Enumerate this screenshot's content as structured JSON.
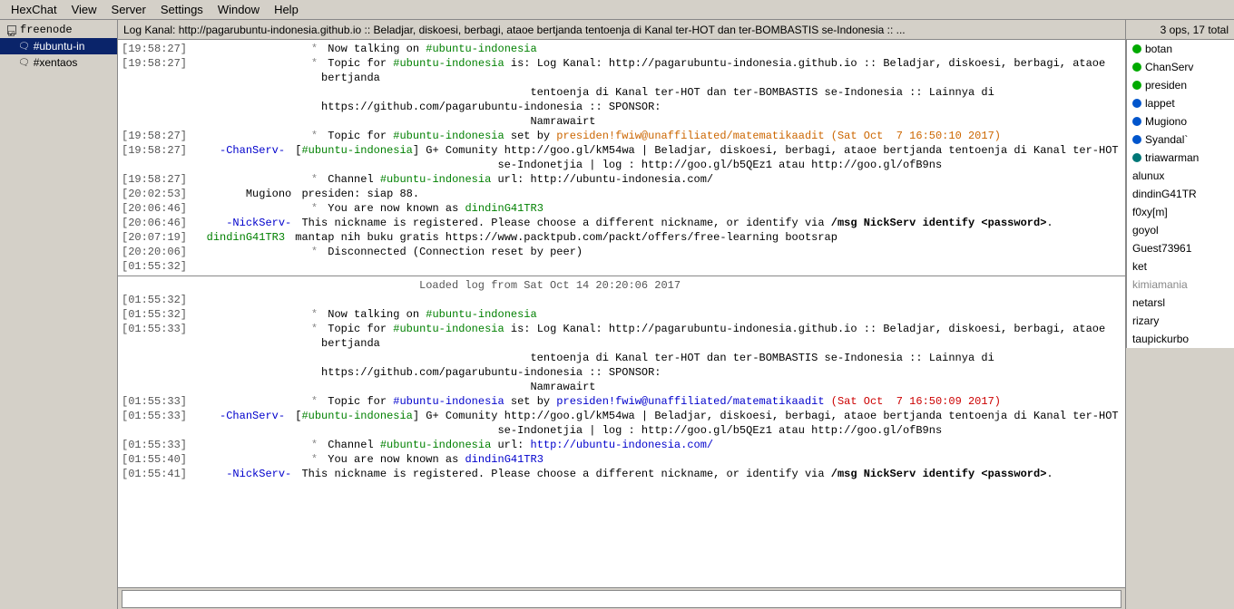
{
  "menubar": {
    "items": [
      "HexChat",
      "View",
      "Server",
      "Settings",
      "Window",
      "Help"
    ]
  },
  "sidebar": {
    "server": "freenode",
    "channels": [
      {
        "name": "#ubuntu-in",
        "active": true
      },
      {
        "name": "#xentaos",
        "active": false
      }
    ]
  },
  "topic": "Log Kanal: http://pagarubuntu-indonesia.github.io :: Beladjar, diskoesi, berbagi, ataoe bertjanda tentoenja di Kanal ter-HOT dan ter-BOMBASTIS se-Indonesia :: ...",
  "ops_header": "3 ops, 17 total",
  "chat_lines": [
    {
      "time": "[19:58:27]",
      "nick": "*",
      "nick_class": "asterisk",
      "msg": "Now talking on #ubuntu-indonesia",
      "msg_type": "plain"
    },
    {
      "time": "[19:58:27]",
      "nick": "*",
      "nick_class": "asterisk",
      "msg": "Topic for #ubuntu-indonesia is: Log Kanal: http://pagarubuntu-indonesia.github.io :: Beladjar, diskoesi, berbagi, ataoe bertjanda tentoenja di Kanal ter-HOT dan ter-BOMBASTIS se-Indonesia :: Lainnya di https://github.com/pagarubuntu-indonesia :: SPONSOR: Namrawairt",
      "msg_type": "plain"
    },
    {
      "time": "[19:58:27]",
      "nick": "*",
      "nick_class": "asterisk",
      "msg": "Topic for #ubuntu-indonesia set by presiden!fwiw@unaffiliated/matematikaadit (Sat Oct  7 16:50:10 2017)",
      "msg_type": "plain"
    },
    {
      "time": "[19:58:27]",
      "nick": "-ChanServ-",
      "nick_class": "chanserv",
      "msg": "[#ubuntu-indonesia] G+ Comunity http://goo.gl/kM54wa | Beladjar, diskoesi, berbagi, ataoe bertjanda tentoenja di Kanal ter-HOT se-Indonetjia | log : http://goo.gl/b5QEz1 atau http://goo.gl/ofB9ns",
      "msg_type": "plain"
    },
    {
      "time": "[19:58:27]",
      "nick": "*",
      "nick_class": "asterisk",
      "msg": "Channel #ubuntu-indonesia url: http://ubuntu-indonesia.com/",
      "msg_type": "plain"
    },
    {
      "time": "[20:02:53]",
      "nick": "Mugiono",
      "nick_class": "user",
      "msg": "presiden: siap 88.",
      "msg_type": "plain"
    },
    {
      "time": "[20:06:46]",
      "nick": "*",
      "nick_class": "asterisk",
      "msg": "You are now known as dindinG41TR3",
      "msg_type": "green"
    },
    {
      "time": "[20:06:46]",
      "nick": "-NickServ-",
      "nick_class": "nickserv",
      "msg_raw": "This nickname is registered. Please choose a different nickname, or identify via /msg NickServ identify <password>.",
      "msg_type": "bold"
    },
    {
      "time": "[20:07:19]",
      "nick": "dindinG41TR3",
      "nick_class": "user",
      "msg": "mantap nih buku gratis https://www.packtpub.com/packt/offers/free-learning bootsrap",
      "msg_type": "plain"
    },
    {
      "time": "[20:20:06]",
      "nick": "*",
      "nick_class": "asterisk",
      "msg": "Disconnected (Connection reset by peer)",
      "msg_type": "plain"
    },
    {
      "time": "[01:55:32]",
      "nick": "*",
      "nick_class": "asterisk",
      "msg": "",
      "msg_type": "plain"
    },
    {
      "time": "",
      "nick": "",
      "nick_class": "",
      "msg": "Loaded log from Sat Oct 14 20:20:06 2017",
      "msg_type": "separator-text"
    },
    {
      "time": "[01:55:32]",
      "nick": "",
      "msg": "",
      "msg_type": "blank"
    },
    {
      "time": "[01:55:32]",
      "nick": "*",
      "nick_class": "asterisk",
      "msg": "Now talking on #ubuntu-indonesia",
      "msg_type": "plain"
    },
    {
      "time": "[01:55:33]",
      "nick": "*",
      "nick_class": "asterisk",
      "msg": "Topic for #ubuntu-indonesia is: Log Kanal: http://pagarubuntu-indonesia.github.io :: Beladjar, diskoesi, berbagi, ataoe bertjanda tentoenja di Kanal ter-HOT dan ter-BOMBASTIS se-Indonesia :: Lainnya di https://github.com/pagarubuntu-indonesia :: SPONSOR: Namrawairt",
      "msg_type": "plain"
    },
    {
      "time": "[01:55:33]",
      "nick": "*",
      "nick_class": "asterisk",
      "msg": "Topic for #ubuntu-indonesia set by presiden!fwiw@unaffiliated/matematikaadit (Sat Oct  7 16:50:09 2017)",
      "msg_type": "topic-set"
    },
    {
      "time": "[01:55:33]",
      "nick": "-ChanServ-",
      "nick_class": "chanserv",
      "msg": "[#ubuntu-indonesia] G+ Comunity http://goo.gl/kM54wa | Beladjar, diskoesi, berbagi, ataoe bertjanda tentoenja di Kanal ter-HOT se-Indonetjia | log : http://goo.gl/b5QEz1 atau http://goo.gl/ofB9ns",
      "msg_type": "plain"
    },
    {
      "time": "[01:55:33]",
      "nick": "*",
      "nick_class": "asterisk",
      "msg": "Channel #ubuntu-indonesia url: http://ubuntu-indonesia.com/",
      "msg_type": "url"
    },
    {
      "time": "[01:55:40]",
      "nick": "*",
      "nick_class": "asterisk",
      "msg": "You are now known as dindinG41TR3",
      "msg_type": "green-nick"
    },
    {
      "time": "[01:55:41]",
      "nick": "-NickServ-",
      "nick_class": "nickserv",
      "msg_raw": "This nickname is registered. Please choose a different nickname, or identify via /msg NickServ identify <password>.",
      "msg_type": "bold"
    }
  ],
  "userlist": {
    "ops": [
      {
        "name": "botan",
        "dot": "green"
      },
      {
        "name": "ChanServ",
        "dot": "green"
      },
      {
        "name": "presiden",
        "dot": "green"
      }
    ],
    "voiced": [
      {
        "name": "lappet",
        "dot": "blue"
      },
      {
        "name": "Mugiono",
        "dot": "blue"
      },
      {
        "name": "Syandal`",
        "dot": "blue"
      },
      {
        "name": "triawarman",
        "dot": "teal"
      }
    ],
    "regular": [
      {
        "name": "alunux",
        "dot": "none"
      },
      {
        "name": "dindinG41TR",
        "dot": "none"
      },
      {
        "name": "f0xy[m]",
        "dot": "none"
      },
      {
        "name": "goyol",
        "dot": "none"
      },
      {
        "name": "Guest73961",
        "dot": "none"
      },
      {
        "name": "ket",
        "dot": "none"
      },
      {
        "name": "kimiamania",
        "dot": "none"
      },
      {
        "name": "netarsl",
        "dot": "none"
      },
      {
        "name": "rizary",
        "dot": "none"
      },
      {
        "name": "taupickurbo",
        "dot": "none"
      }
    ]
  }
}
